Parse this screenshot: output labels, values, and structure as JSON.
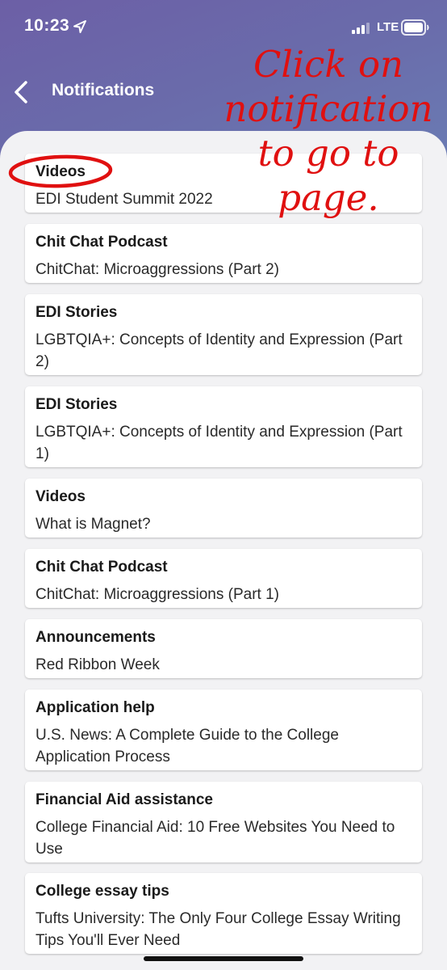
{
  "status_bar": {
    "time": "10:23",
    "network": "LTE"
  },
  "nav": {
    "title": "Notifications"
  },
  "annotation": {
    "lines": [
      "Click on",
      "notification",
      "to go to",
      "page."
    ],
    "color": "#e01010"
  },
  "notifications": [
    {
      "title": "Videos",
      "subtitle": "EDI Student Summit 2022"
    },
    {
      "title": "Chit Chat Podcast",
      "subtitle": "ChitChat: Microaggressions (Part 2)"
    },
    {
      "title": "EDI Stories",
      "subtitle": "LGBTQIA+: Concepts of Identity and Expression (Part 2)"
    },
    {
      "title": "EDI Stories",
      "subtitle": "LGBTQIA+: Concepts of Identity and Expression (Part 1)"
    },
    {
      "title": "Videos",
      "subtitle": "What is Magnet?"
    },
    {
      "title": "Chit Chat Podcast",
      "subtitle": "ChitChat: Microaggressions (Part 1)"
    },
    {
      "title": "Announcements",
      "subtitle": "Red Ribbon Week"
    },
    {
      "title": "Application help",
      "subtitle": "U.S. News: A Complete Guide to the College Application Process"
    },
    {
      "title": "Financial Aid assistance",
      "subtitle": "College Financial Aid: 10 Free Websites You Need to Use"
    },
    {
      "title": "College essay tips",
      "subtitle": "Tufts University: The Only Four College Essay Writing Tips You'll Ever Need"
    }
  ],
  "icons": {
    "location": "location-arrow-icon",
    "signal": "cellular-signal-icon",
    "battery": "battery-icon",
    "back": "chevron-left-icon"
  }
}
